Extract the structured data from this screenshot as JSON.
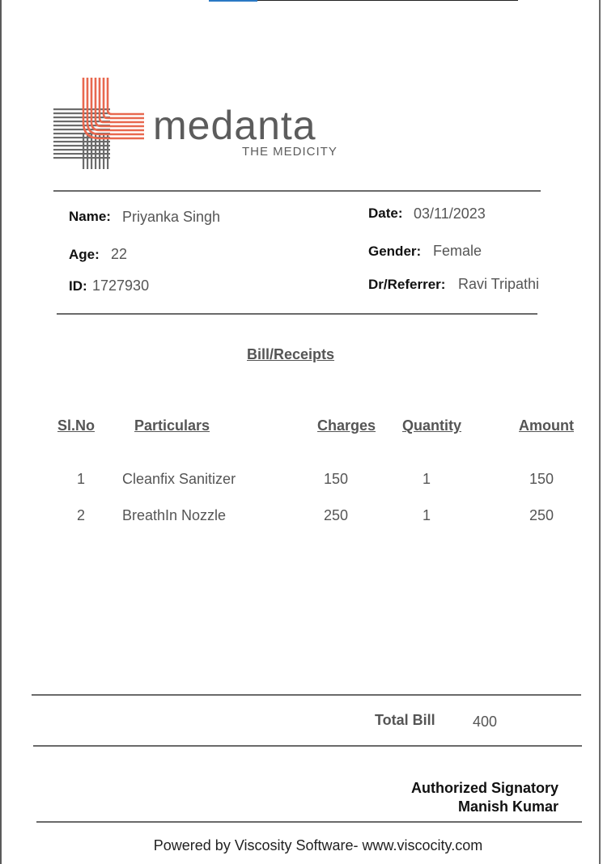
{
  "logo": {
    "brand": "medanta",
    "tagline": "THE MEDICITY",
    "colors": {
      "accent": "#e8684f",
      "grey": "#5c5c5c"
    }
  },
  "patient": {
    "name_label": "Name:",
    "name": "Priyanka Singh",
    "age_label": "Age:",
    "age": "22",
    "id_label": "ID:",
    "id": "1727930",
    "date_label": "Date:",
    "date": "03/11/2023",
    "gender_label": "Gender:",
    "gender": "Female",
    "doctor_label": "Dr/Referrer:",
    "doctor": "Ravi Tripathi"
  },
  "bill": {
    "title": "Bill/Receipts",
    "headers": {
      "slno": "Sl.No",
      "particulars": "Particulars",
      "charges": "Charges",
      "quantity": "Quantity",
      "amount": "Amount"
    },
    "rows": [
      {
        "slno": "1",
        "particulars": "Cleanfix Sanitizer",
        "charges": "150",
        "quantity": "1",
        "amount": "150"
      },
      {
        "slno": "2",
        "particulars": "BreathIn Nozzle",
        "charges": "250",
        "quantity": "1",
        "amount": "250"
      }
    ],
    "total_label": "Total Bill",
    "total": "400"
  },
  "signatory": {
    "title": "Authorized Signatory",
    "name": "Manish Kumar"
  },
  "footer": {
    "text": "Powered by Viscosity Software- www.viscocity.com"
  }
}
